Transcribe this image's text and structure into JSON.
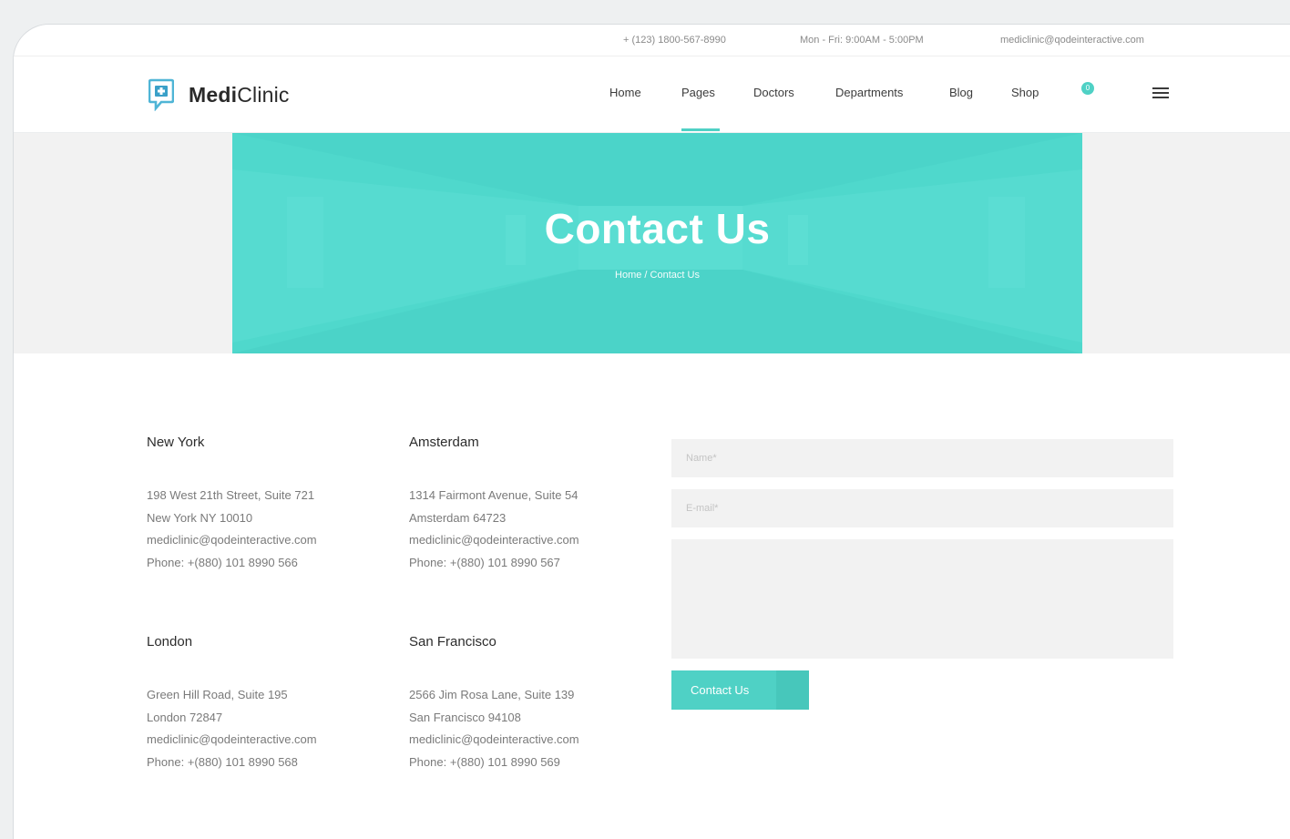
{
  "topbar": {
    "phone": "+ (123) 1800-567-8990",
    "hours": "Mon - Fri: 9:00AM - 5:00PM",
    "email": "mediclinic@qodeinteractive.com"
  },
  "logo": {
    "bold": "Medi",
    "regular": "Clinic"
  },
  "nav": {
    "items": [
      "Home",
      "Pages",
      "Doctors",
      "Departments",
      "Blog",
      "Shop"
    ],
    "active": "Pages",
    "cart_count": "0"
  },
  "hero": {
    "title": "Contact Us",
    "breadcrumb": [
      "Home",
      "/",
      "Contact Us"
    ]
  },
  "offices": [
    {
      "city": "New York",
      "lines": [
        "198 West 21th Street, Suite 721",
        " New York NY 10010",
        "mediclinic@qodeinteractive.com",
        "Phone: +(880) 101 8990 566"
      ]
    },
    {
      "city": "Amsterdam",
      "lines": [
        "1314 Fairmont Avenue, Suite 54",
        "Amsterdam 64723",
        "mediclinic@qodeinteractive.com",
        "Phone: +(880) 101 8990 567"
      ]
    },
    {
      "city": "London",
      "lines": [
        "Green Hill Road, Suite 195",
        " London 72847",
        "mediclinic@qodeinteractive.com",
        "Phone: +(880) 101 8990 568"
      ]
    },
    {
      "city": "San Francisco",
      "lines": [
        "2566 Jim Rosa Lane, Suite 139",
        " San Francisco 94108",
        "mediclinic@qodeinteractive.com",
        "Phone: +(880) 101 8990 569"
      ]
    }
  ],
  "form": {
    "name_placeholder": "Name*",
    "email_placeholder": "E-mail*",
    "message_placeholder": "",
    "submit_label": "Contact Us"
  },
  "colors": {
    "accent": "#4fd1c5",
    "hero": "#4fd8cc"
  }
}
